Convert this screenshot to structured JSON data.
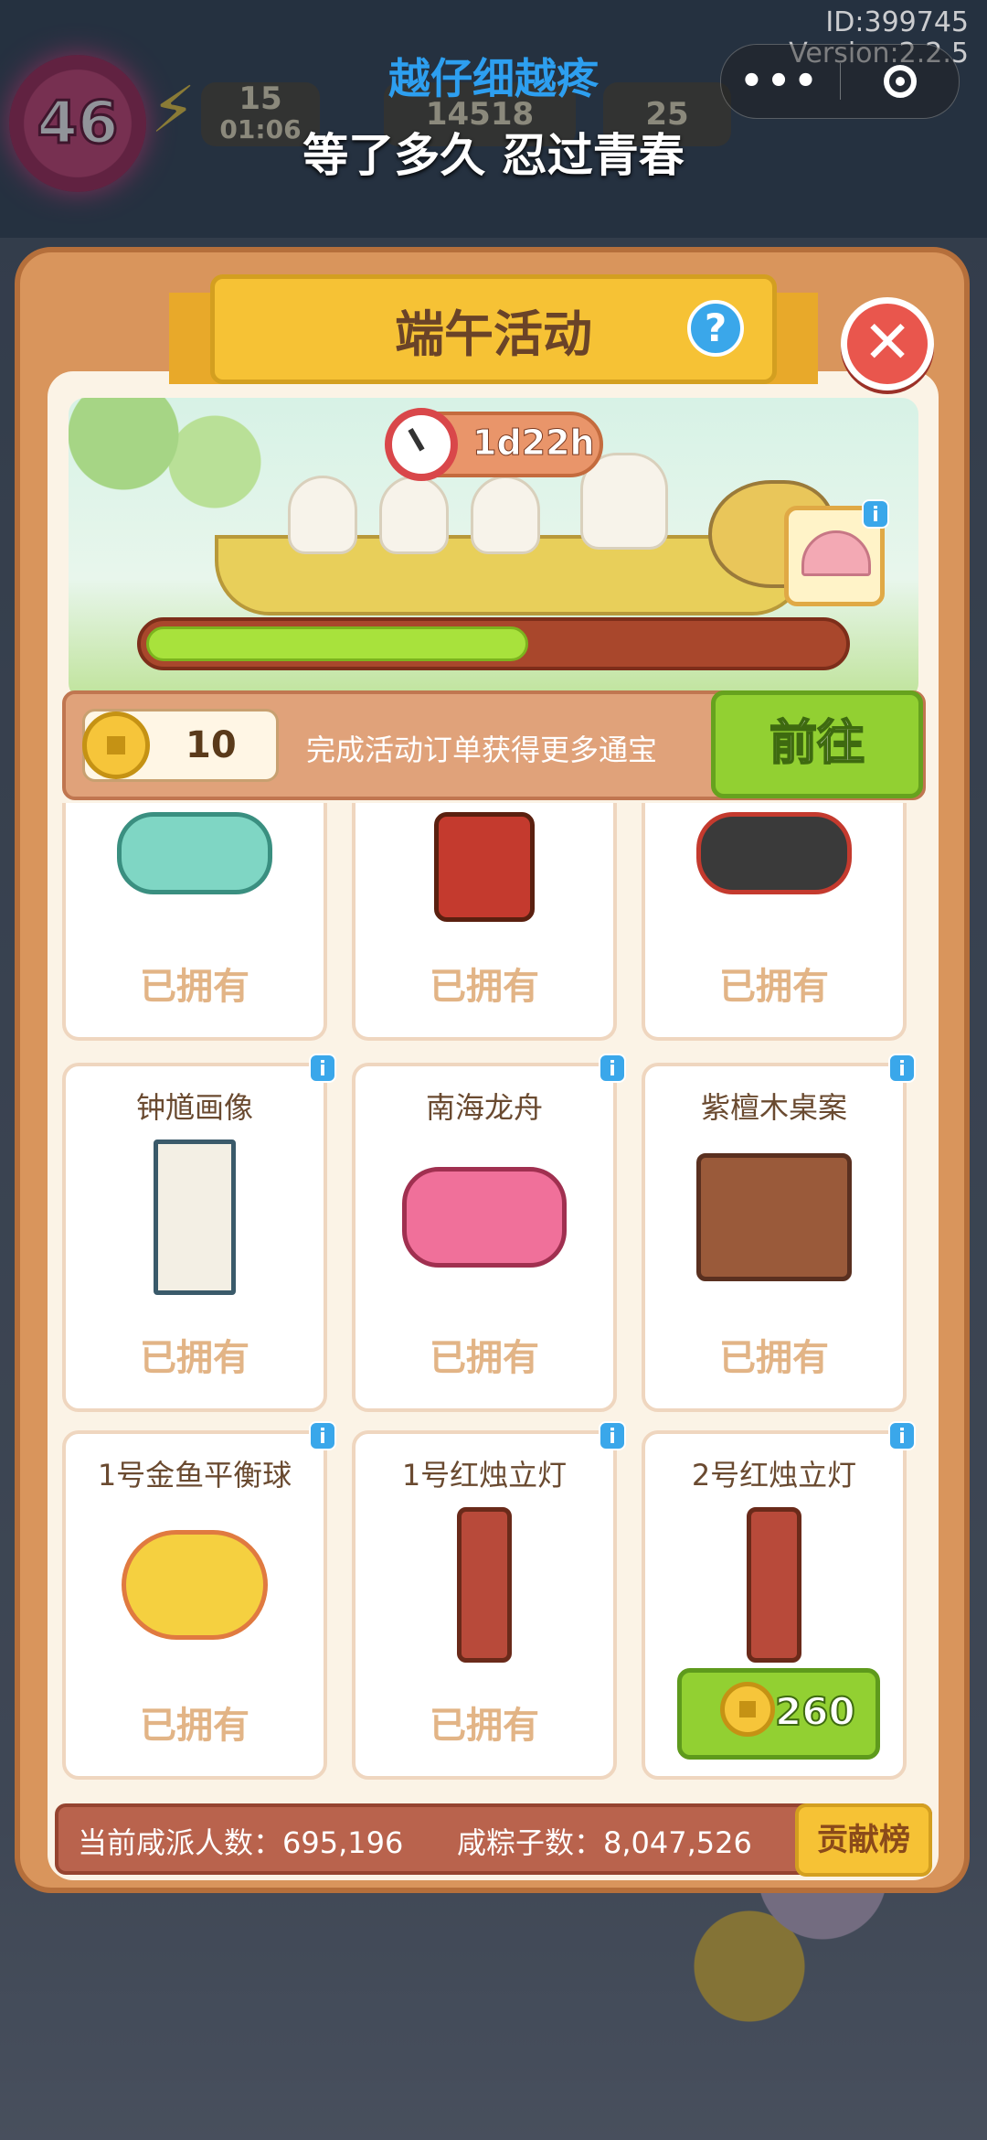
{
  "status": {
    "id_text": "ID:399745",
    "version_text": "Version:2.2.5"
  },
  "miniprogram": {
    "title": "越仔细越疼",
    "subtitle": "等了多久 忍过青春"
  },
  "hud": {
    "level": "46",
    "energy": "15",
    "energy_timer": "01:06",
    "coins": "14518",
    "gems": "25"
  },
  "event": {
    "title": "端午活动",
    "timer": "1d22h",
    "progress_fraction": 0.55,
    "coin_count": "10",
    "coinbar_text": "完成活动订单获得更多通宝",
    "goto_label": "前往"
  },
  "items": [
    {
      "name": "",
      "status": "已拥有",
      "icon": "jade-dragon-boat-icon"
    },
    {
      "name": "",
      "status": "已拥有",
      "icon": "zhong-kui-statue-icon"
    },
    {
      "name": "",
      "status": "已拥有",
      "icon": "black-dragon-boat-icon"
    },
    {
      "name": "钟馗画像",
      "status": "已拥有",
      "icon": "zhong-kui-portrait-icon"
    },
    {
      "name": "南海龙舟",
      "status": "已拥有",
      "icon": "south-sea-dragon-boat-icon"
    },
    {
      "name": "紫檀木桌案",
      "status": "已拥有",
      "icon": "rosewood-desk-icon"
    },
    {
      "name": "1号金鱼平衡球",
      "status": "已拥有",
      "icon": "goldfish-balance-ball-icon"
    },
    {
      "name": "1号红烛立灯",
      "status": "已拥有",
      "icon": "red-candle-lamp-icon"
    },
    {
      "name": "2号红烛立灯",
      "price": "260",
      "icon": "red-candle-lamp-icon"
    }
  ],
  "footer": {
    "participants_text": "当前咸派人数：695,196",
    "zongzi_text": "咸粽子数：8,047,526",
    "rank_label": "贡献榜"
  },
  "colors": {
    "accent_green": "#92d032",
    "banner_yellow": "#f6c235",
    "info_blue": "#3aa7ea",
    "close_red": "#e9564d"
  }
}
